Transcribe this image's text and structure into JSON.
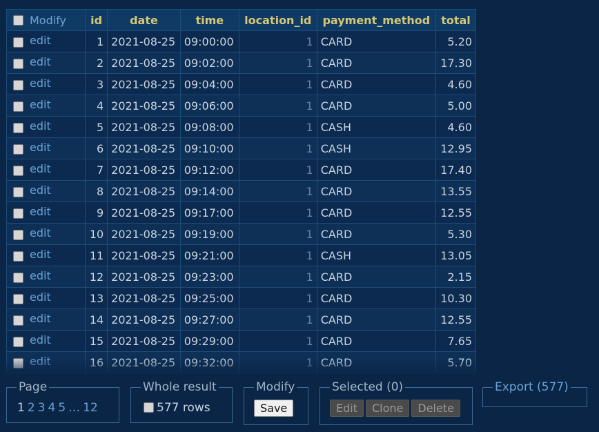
{
  "table": {
    "columns": [
      "Modify",
      "id",
      "date",
      "time",
      "location_id",
      "payment_method",
      "total"
    ],
    "edit_label": "edit",
    "rows": [
      [
        "1",
        "2021-08-25",
        "09:00:00",
        "1",
        "CARD",
        "5.20"
      ],
      [
        "2",
        "2021-08-25",
        "09:02:00",
        "1",
        "CARD",
        "17.30"
      ],
      [
        "3",
        "2021-08-25",
        "09:04:00",
        "1",
        "CARD",
        "4.60"
      ],
      [
        "4",
        "2021-08-25",
        "09:06:00",
        "1",
        "CARD",
        "5.00"
      ],
      [
        "5",
        "2021-08-25",
        "09:08:00",
        "1",
        "CASH",
        "4.60"
      ],
      [
        "6",
        "2021-08-25",
        "09:10:00",
        "1",
        "CASH",
        "12.95"
      ],
      [
        "7",
        "2021-08-25",
        "09:12:00",
        "1",
        "CARD",
        "17.40"
      ],
      [
        "8",
        "2021-08-25",
        "09:14:00",
        "1",
        "CARD",
        "13.55"
      ],
      [
        "9",
        "2021-08-25",
        "09:17:00",
        "1",
        "CARD",
        "12.55"
      ],
      [
        "10",
        "2021-08-25",
        "09:19:00",
        "1",
        "CARD",
        "5.30"
      ],
      [
        "11",
        "2021-08-25",
        "09:21:00",
        "1",
        "CASH",
        "13.05"
      ],
      [
        "12",
        "2021-08-25",
        "09:23:00",
        "1",
        "CARD",
        "2.15"
      ],
      [
        "13",
        "2021-08-25",
        "09:25:00",
        "1",
        "CARD",
        "10.30"
      ],
      [
        "14",
        "2021-08-25",
        "09:27:00",
        "1",
        "CARD",
        "12.55"
      ],
      [
        "15",
        "2021-08-25",
        "09:29:00",
        "1",
        "CARD",
        "7.65"
      ],
      [
        "16",
        "2021-08-25",
        "09:32:00",
        "1",
        "CARD",
        "5.70"
      ]
    ]
  },
  "page": {
    "legend": "Page",
    "pages": [
      "1",
      "2",
      "3",
      "4",
      "5",
      "…",
      "12"
    ],
    "current": "1"
  },
  "whole_result": {
    "legend": "Whole result",
    "checkbox_label": "577 rows"
  },
  "modify": {
    "legend": "Modify",
    "save_label": "Save"
  },
  "selected": {
    "legend": "Selected (0)",
    "edit_label": "Edit",
    "clone_label": "Clone",
    "delete_label": "Delete"
  },
  "export": {
    "legend": "Export (577)"
  },
  "colors": {
    "background": "#0a2546",
    "header_text": "#d6c878",
    "link": "#6aa4d8",
    "border": "#1b4d7a"
  }
}
